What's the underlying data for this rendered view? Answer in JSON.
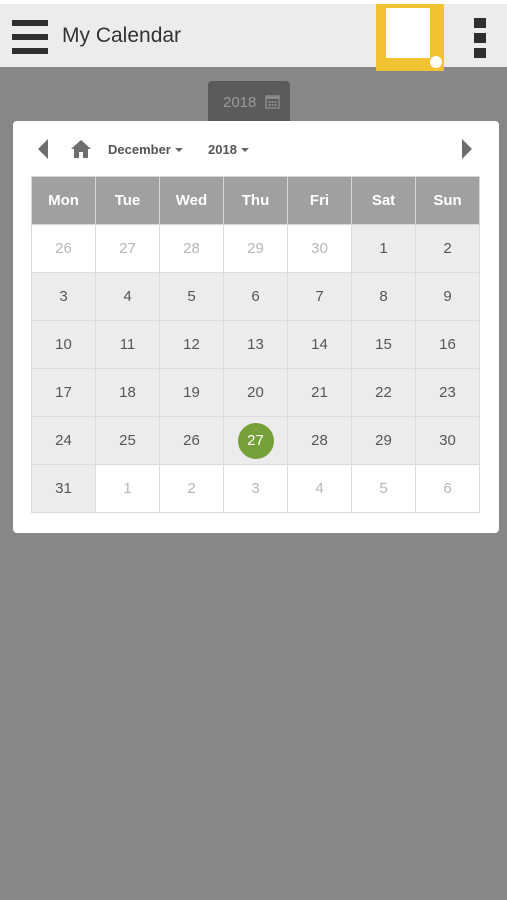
{
  "app": {
    "title": "My Calendar"
  },
  "year_field": {
    "value": "2018"
  },
  "calendar": {
    "month_label": "December",
    "year_label": "2018",
    "weekdays": [
      "Mon",
      "Tue",
      "Wed",
      "Thu",
      "Fri",
      "Sat",
      "Sun"
    ],
    "weeks": [
      [
        "26",
        "27",
        "28",
        "29",
        "30",
        "1",
        "2"
      ],
      [
        "3",
        "4",
        "5",
        "6",
        "7",
        "8",
        "9"
      ],
      [
        "10",
        "11",
        "12",
        "13",
        "14",
        "15",
        "16"
      ],
      [
        "17",
        "18",
        "19",
        "20",
        "21",
        "22",
        "23"
      ],
      [
        "24",
        "25",
        "26",
        "27",
        "28",
        "29",
        "30"
      ],
      [
        "31",
        "1",
        "2",
        "3",
        "4",
        "5",
        "6"
      ]
    ],
    "selected_day": "27"
  },
  "colors": {
    "selected": "#76a13a",
    "logo": "#f1c232",
    "header_row": "#a0a0a0"
  }
}
